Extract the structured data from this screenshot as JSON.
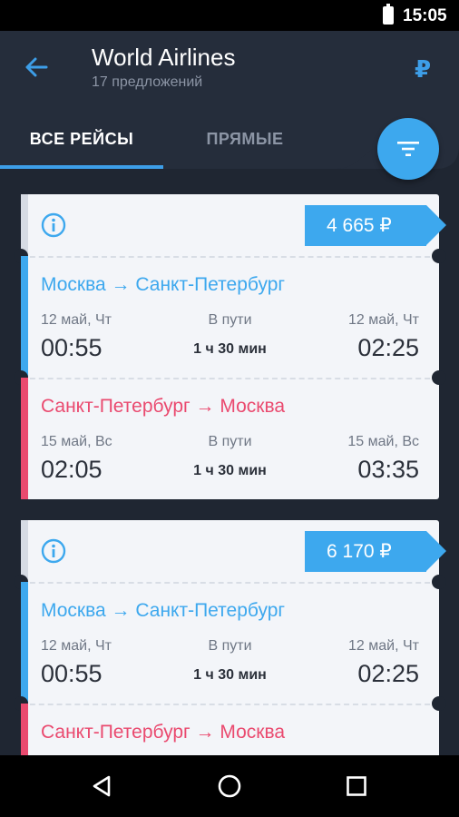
{
  "status_bar": {
    "time": "15:05",
    "battery_icon": "battery-icon"
  },
  "app_bar": {
    "title": "World Airlines",
    "subtitle": "17 предложений",
    "currency_symbol": "₽"
  },
  "tabs": [
    {
      "label": "ВСЕ РЕЙСЫ",
      "active": true
    },
    {
      "label": "ПРЯМЫЕ",
      "active": false
    }
  ],
  "colors": {
    "accent": "#3da8ee",
    "outbound": "#3da8ee",
    "return": "#ea4a6f",
    "background": "#1f2632",
    "card": "#f3f5f9"
  },
  "tickets": [
    {
      "price": "4 665 ₽",
      "legs": [
        {
          "route": "Москва → Санкт-Петербург",
          "dep_date": "12 май, Чт",
          "dep_time": "00:55",
          "dur_label": "В пути",
          "duration": "1 ч 30 мин",
          "arr_date": "12 май, Чт",
          "arr_time": "02:25"
        },
        {
          "route": "Санкт-Петербург → Москва",
          "dep_date": "15 май, Вс",
          "dep_time": "02:05",
          "dur_label": "В пути",
          "duration": "1 ч 30 мин",
          "arr_date": "15 май, Вс",
          "arr_time": "03:35"
        }
      ]
    },
    {
      "price": "6 170 ₽",
      "legs": [
        {
          "route": "Москва → Санкт-Петербург",
          "dep_date": "12 май, Чт",
          "dep_time": "00:55",
          "dur_label": "В пути",
          "duration": "1 ч 30 мин",
          "arr_date": "12 май, Чт",
          "arr_time": "02:25"
        },
        {
          "route": "Санкт-Петербург → Москва"
        }
      ]
    }
  ]
}
